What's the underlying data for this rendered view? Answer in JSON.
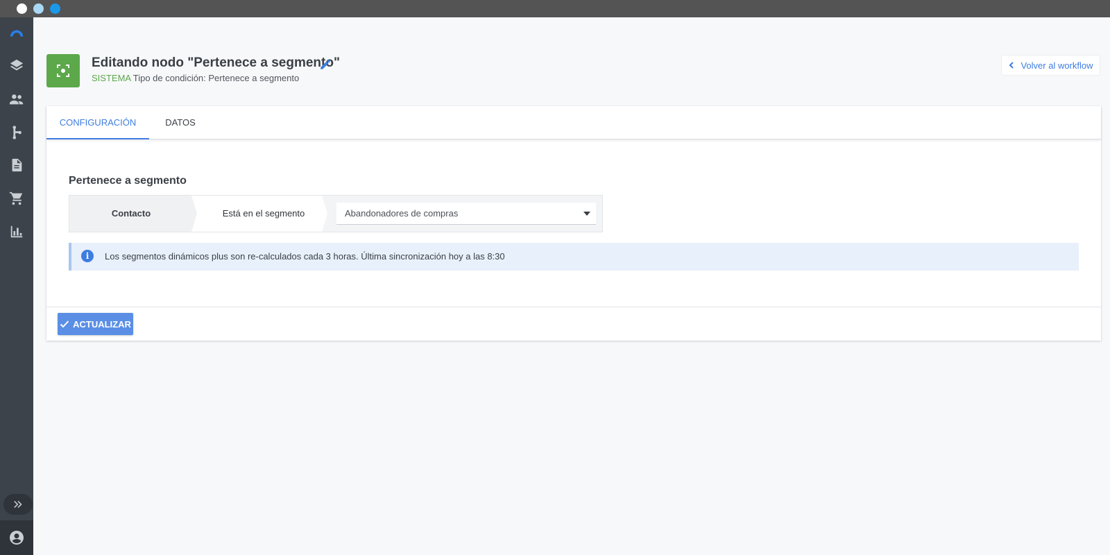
{
  "window": {
    "controls": [
      "close",
      "minimize",
      "maximize"
    ]
  },
  "sidebar": {
    "items": [
      {
        "icon": "logo-arc-icon"
      },
      {
        "icon": "layers-icon"
      },
      {
        "icon": "people-icon"
      },
      {
        "icon": "workflow-branch-icon"
      },
      {
        "icon": "document-icon"
      },
      {
        "icon": "cart-icon"
      },
      {
        "icon": "bar-chart-icon"
      }
    ],
    "expand_icon": "double-chevron-right-icon",
    "user_icon": "account-circle-icon"
  },
  "header": {
    "title": "Editando nodo \"Pertenece a segmento\"",
    "edit_icon": "pencil-icon",
    "badge_icon": "segment-focus-icon",
    "badge_color": "#5ca84a",
    "system_label": "SISTEMA",
    "condition_type": "Tipo de condición: Pertenece a segmento",
    "back_button": "Volver al workflow"
  },
  "tabs": [
    {
      "label": "CONFIGURACIÓN",
      "active": true
    },
    {
      "label": "DATOS",
      "active": false
    }
  ],
  "section": {
    "title": "Pertenece a segmento",
    "condition": {
      "subject": "Contacto",
      "operator": "Está en el segmento",
      "selected_segment": "Abandonadores de compras"
    },
    "info_message": "Los segmentos dinámicos plus son re-calculados cada 3 horas. Última sincronización hoy a las 8:30",
    "info_icon": "info-icon"
  },
  "footer": {
    "update_button": "ACTUALIZAR",
    "update_icon": "check-icon"
  },
  "colors": {
    "accent": "#3e7de0",
    "success": "#5ca84a",
    "sidebar": "#3c434a"
  }
}
